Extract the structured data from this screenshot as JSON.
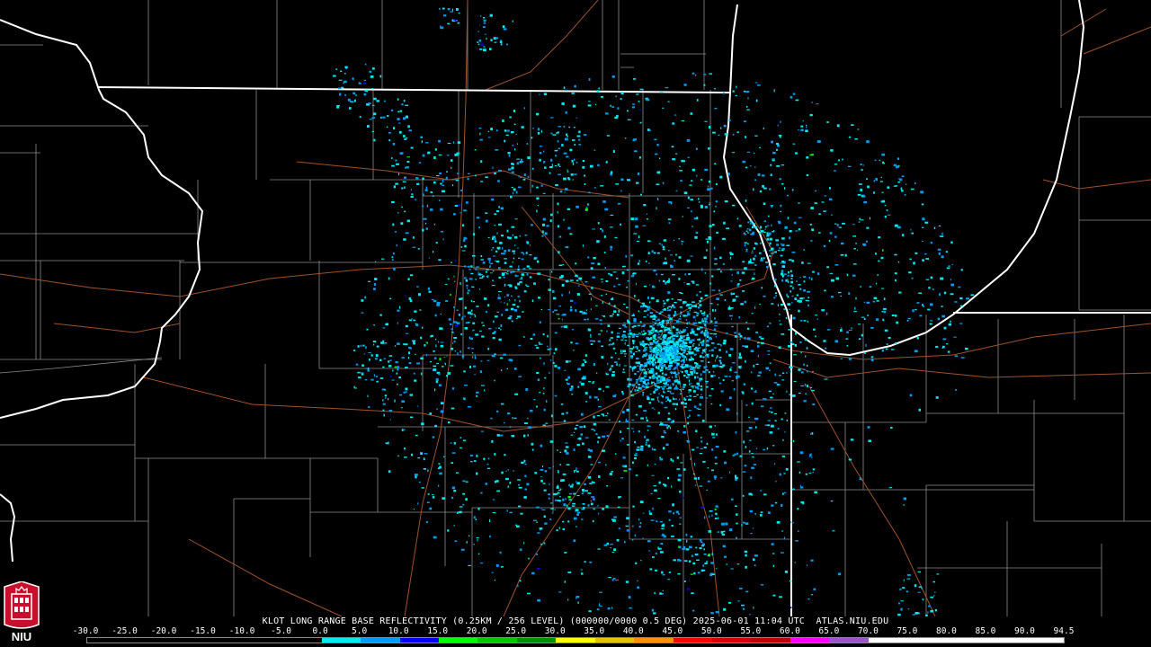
{
  "header": {
    "radar": "KLOT",
    "product": "LONG RANGE BASE REFLECTIVITY (0.25KM / 256 LEVEL)",
    "caption": "KLOT LONG RANGE BASE REFLECTIVITY (0.25KM / 256 LEVEL) (000000/0000 0.5 DEG) 2025-06-01 11:04 UTC  ATLAS.NIU.EDU"
  },
  "scale": {
    "labels": [
      "-30.0",
      "-25.0",
      "-20.0",
      "-15.0",
      "-10.0",
      "-5.0",
      "0.0",
      "5.0",
      "10.0",
      "15.0",
      "20.0",
      "25.0",
      "30.0",
      "35.0",
      "40.0",
      "45.0",
      "50.0",
      "55.0",
      "60.0",
      "65.0",
      "70.0",
      "75.0",
      "80.0",
      "85.0",
      "90.0",
      "94.5"
    ],
    "colors": [
      "#000000",
      "#000000",
      "#000000",
      "#000000",
      "#000000",
      "#000000",
      "#00e8f0",
      "#009cf0",
      "#0000ff",
      "#00ff00",
      "#00c800",
      "#009000",
      "#ffff00",
      "#e7c000",
      "#ff9000",
      "#ff0000",
      "#d60000",
      "#c00000",
      "#ff00ff",
      "#9955c9",
      "#ffffff",
      "#ffffff",
      "#ffffff",
      "#ffffff",
      "#ffffff"
    ]
  },
  "logo": {
    "text": "NIU",
    "color": "#c8102e"
  },
  "map_colors": {
    "state": "#ffffff",
    "county": "#8c8c8c",
    "highway": "#a0522d",
    "background": "#000000"
  },
  "radar_site": {
    "name": "KLOT"
  }
}
